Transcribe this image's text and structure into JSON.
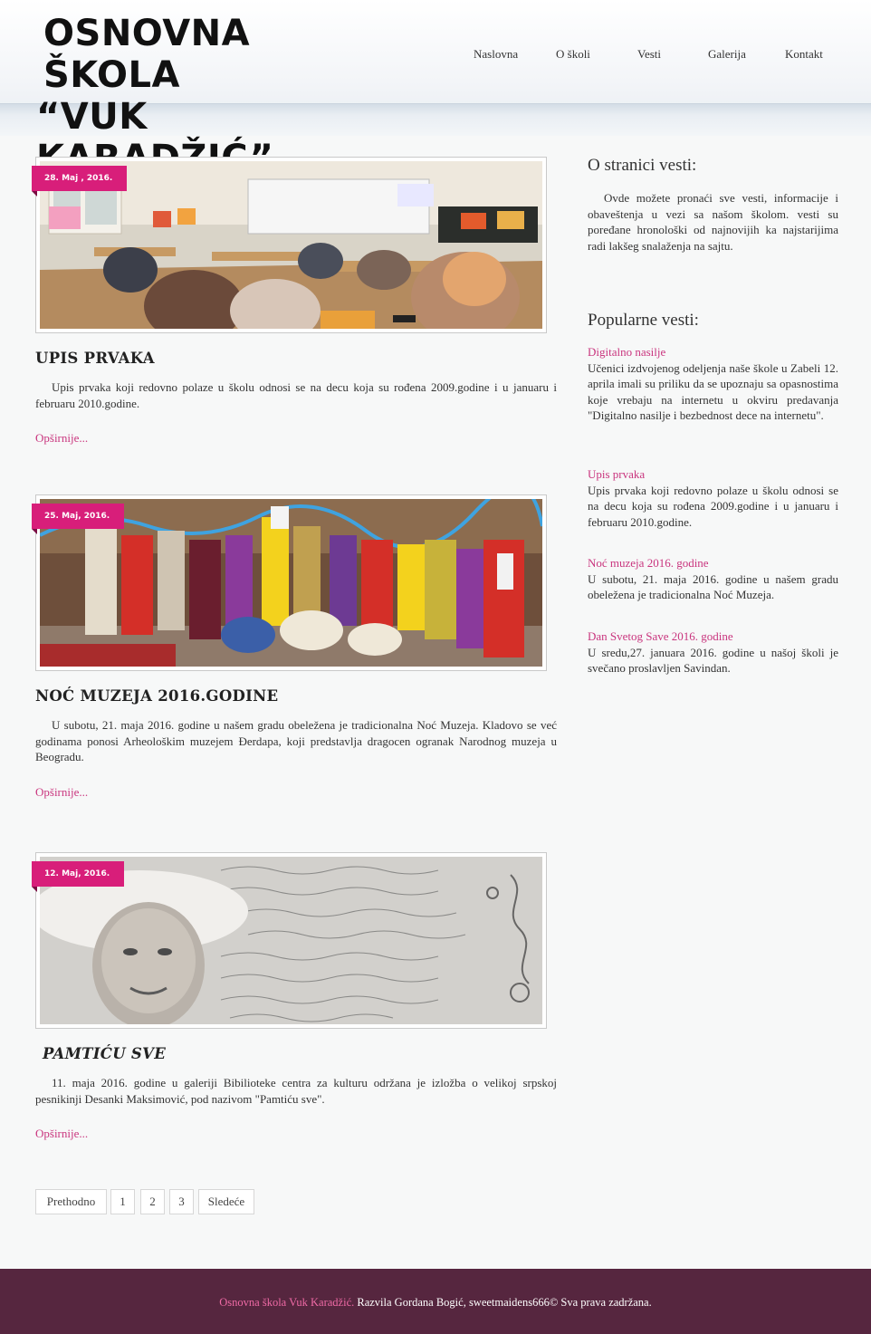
{
  "header": {
    "logo_line1": "OSNOVNA ŠKOLA",
    "logo_line2": "“VUK KARADŽIĆ”",
    "nav": [
      "Naslovna",
      "O školi",
      "Vesti",
      "Galerija",
      "Kontakt"
    ]
  },
  "articles": [
    {
      "date": "28. Maj , 2016.",
      "title": "UPIS PRVAKA",
      "body": "Upis prvaka koji redovno polaze u školu odnosi se na decu koja su rođena 2009.godine i u januaru i februaru 2010.godine.",
      "more": "Opširnije..."
    },
    {
      "date": "25. Maj, 2016.",
      "title": "NOĆ MUZEJA 2016.GODINE",
      "body": "U subotu, 21. maja 2016. godine u našem gradu obeležena je tradicionalna Noć Muzeja. Kladovo se već godinama ponosi Arheološkim muzejem Đerdapa, koji predstavlja dragocen ogranak Narodnog muzeja u Beogradu.",
      "more": "Opširnije..."
    },
    {
      "date": "12. Maj, 2016.",
      "title": "PAMTIĆU SVE",
      "body": "11. maja 2016. godine u galeriji Bibilioteke centra za kulturu održana je izložba o velikoj srpskoj pesnikinji Desanki Maksimović, pod nazivom \"Pamtiću sve\".",
      "more": "Opširnije..."
    }
  ],
  "sidebar": {
    "about_title": "O stranici vesti:",
    "about_text": "Ovde možete pronaći sve vesti, informacije i obaveštenja u vezi sa našom školom. vesti su poređane hronološki od najnovijih ka najstarijima radi lakšeg snalaženja na sajtu.",
    "popular_title": "Popularne vesti:",
    "popular": [
      {
        "title": "Digitalno nasilje",
        "text": "Učenici izdvojenog odeljenja naše škole u Zabeli 12. aprila imali su priliku da se upoznaju sa opasnostima koje vrebaju na internetu u okviru predavanja \"Digitalno nasilje i bezbednost dece na internetu\"."
      },
      {
        "title": "Upis prvaka",
        "text": "Upis prvaka koji redovno polaze u školu odnosi se na decu koja su rođena 2009.godine i u januaru i februaru 2010.godine."
      },
      {
        "title": "Noć muzeja 2016. godine",
        "text": "U subotu, 21. maja 2016. godine u našem gradu obeležena je tradicionalna Noć Muzeja."
      },
      {
        "title": "Dan Svetog Save 2016. godine",
        "text": "U sredu,27. januara 2016. godine u našoj školi je svečano proslavljen Savindan."
      }
    ]
  },
  "pagination": [
    "Prethodno",
    "1",
    "2",
    "3",
    "Sledeće"
  ],
  "footer": {
    "brand": "Osnovna škola Vuk Karadžić.",
    "rest": " Razvila Gordana Bogić, sweetmaidens666© Sva prava zadržana."
  },
  "colors": {
    "accent": "#d81e7a",
    "link": "#c9357e",
    "footer_bg": "#56263f"
  }
}
